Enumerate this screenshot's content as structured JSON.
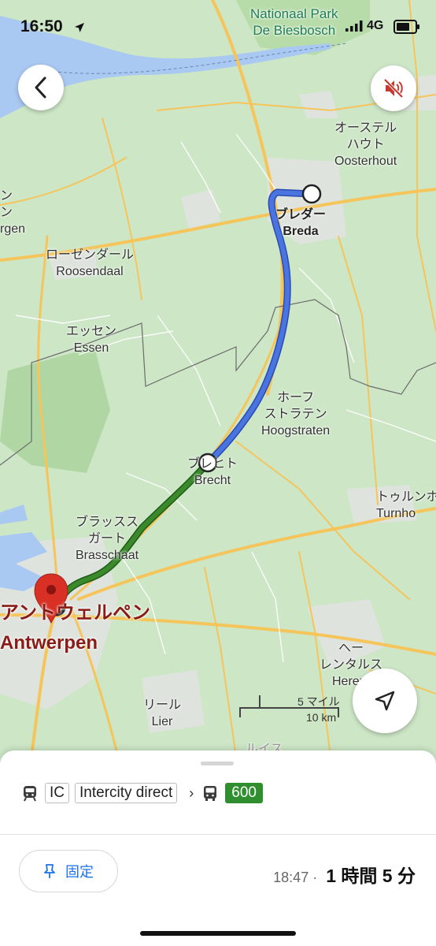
{
  "status_bar": {
    "time": "16:50",
    "network": "4G"
  },
  "map": {
    "labels": {
      "park": "Nationaal Park\nDe Biesbosch",
      "oosterhout": "オーステル\nハウト\nOosterhout",
      "breda": "ブレダー\nBreda",
      "roosendaal": "ローゼンダール\nRoosendaal",
      "essen": "エッセン\nEssen",
      "bergen": "ン\nン\nrgen",
      "hoogstraten": "ホーフ\nストラテン\nHoogstraten",
      "brecht": "ブレヒト\nBrecht",
      "brasschaat": "ブラッスス\nガート\nBrasschaat",
      "turnhout": "トゥルンホ\nTurnho",
      "antwerpen_jp": "アントウェルペン",
      "antwerpen": "Antwerpen",
      "herentals": "ヘー\nレンタルス\nHerent",
      "lier": "リール\nLier",
      "bottom_partial": "ルイス"
    },
    "scale": {
      "miles": "5 マイル",
      "km": "10 km"
    }
  },
  "route": {
    "segments": [
      {
        "type": "train-icon"
      },
      {
        "type": "tag",
        "text": "IC"
      },
      {
        "type": "tag",
        "text": "Intercity direct"
      },
      {
        "type": "chevron",
        "text": "›"
      },
      {
        "type": "bus-icon"
      },
      {
        "type": "tag-green",
        "text": "600"
      }
    ],
    "pin_label": "固定",
    "arrival": "18:47",
    "separator": "·",
    "duration": "1 時間 5 分"
  },
  "colors": {
    "water": "#a9c8f2",
    "land": "#cde6c6",
    "road": "#f5c55b",
    "blue_route": "#4a74e0",
    "green_route": "#3a8a2c",
    "red_pin": "#d93025"
  }
}
